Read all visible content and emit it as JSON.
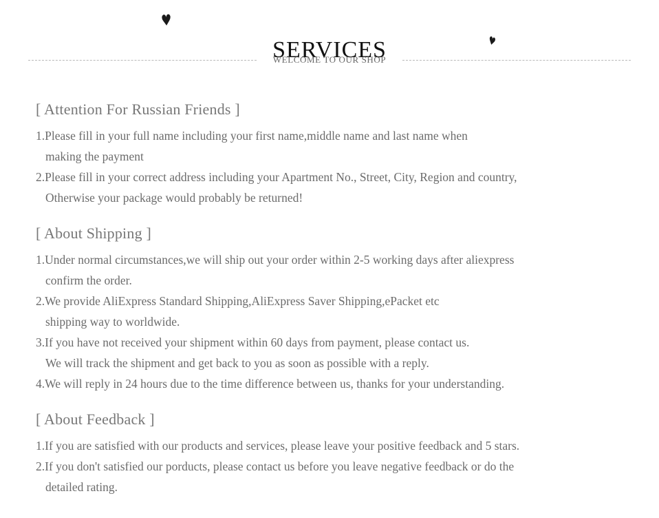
{
  "header": {
    "title": "SERVICES",
    "subtitle": "WELCOME TO OUR SHOP",
    "heart_left": "♥",
    "heart_right": "♥"
  },
  "sections": [
    {
      "title": "[ Attention For Russian Friends ]",
      "items": [
        {
          "lines": [
            "1.Please fill in your full name including your first name,middle name and last name when",
            "making the payment"
          ]
        },
        {
          "lines": [
            "2.Please fill in your correct address including your Apartment No., Street, City, Region and country,",
            "Otherwise your package would probably be returned!"
          ]
        }
      ]
    },
    {
      "title": "[ About Shipping ]",
      "items": [
        {
          "lines": [
            "1.Under normal circumstances,we will ship out your order within 2-5 working days after aliexpress",
            "confirm the order."
          ]
        },
        {
          "lines": [
            "2.We provide AliExpress Standard Shipping,AliExpress Saver Shipping,ePacket etc",
            "shipping way to worldwide."
          ]
        },
        {
          "lines": [
            "3.If you have not received your shipment within 60 days from payment, please contact us.",
            "We will track the shipment and get back to you as soon as possible with a reply."
          ]
        },
        {
          "lines": [
            "4.We will reply in 24 hours due to the time difference between us, thanks for your understanding."
          ]
        }
      ]
    },
    {
      "title": "[ About Feedback ]",
      "items": [
        {
          "lines": [
            "1.If you are satisfied with our products and services, please leave your positive feedback and 5 stars."
          ]
        },
        {
          "lines": [
            "2.If you don't satisfied our porducts, please contact us before you leave negative feedback or do the",
            "detailed rating."
          ]
        }
      ]
    }
  ],
  "colors": {
    "title": "#111111",
    "body_text": "#6b6b6b",
    "section_title": "#777777",
    "rule": "#b9b9b9",
    "background": "#ffffff"
  }
}
